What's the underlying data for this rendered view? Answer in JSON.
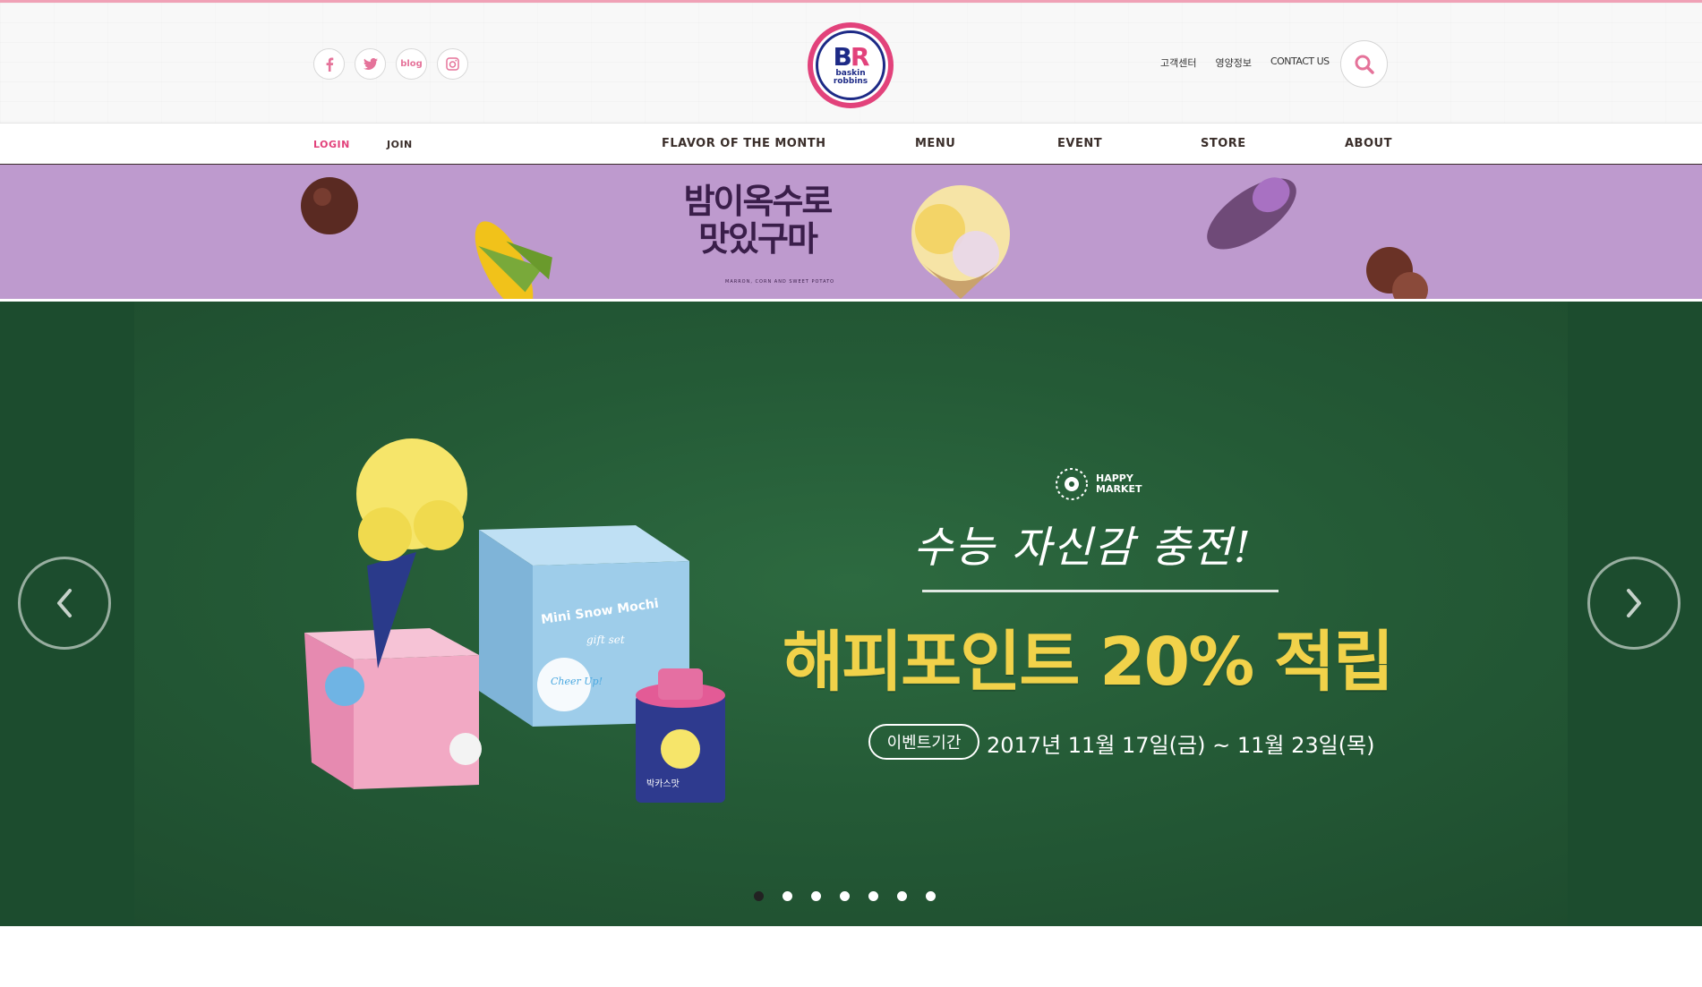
{
  "header": {
    "social": [
      {
        "name": "facebook",
        "label": "f"
      },
      {
        "name": "twitter",
        "label": ""
      },
      {
        "name": "blog",
        "label": "blog"
      },
      {
        "name": "instagram",
        "label": ""
      }
    ],
    "logo": {
      "initials_b": "B",
      "initials_r": "R",
      "line1": "baskin",
      "line2": "robbins"
    },
    "utility_links": [
      "고객센터",
      "영양정보",
      "CONTACT US"
    ]
  },
  "nav": {
    "login": "LOGIN",
    "join": "JOIN",
    "items": [
      "FLAVOR OF THE MONTH",
      "MENU",
      "EVENT",
      "STORE",
      "ABOUT"
    ]
  },
  "flavor_banner": {
    "title": "밤이옥수로 맛있구마",
    "caption": "MARRON, CORN AND SWEET POTATO"
  },
  "hero": {
    "brand": {
      "line1": "HAPPY",
      "line2": "MARKET"
    },
    "headline": "수능 자신감 충전!",
    "promo": "해피포인트 20% 적립",
    "period_label": "이벤트기간",
    "period": "2017년 11월 17일(금) ~ 11월 23일(목)",
    "products": {
      "box1": "Mini Snow Mochi",
      "box1_sub": "gift set",
      "cheer": "Cheer Up!",
      "cup": "박카스맛"
    }
  },
  "carousel": {
    "total": 7,
    "active": 1
  },
  "colors": {
    "brand_pink": "#e2427b",
    "brand_navy": "#1d2a86",
    "chalkboard": "#245a36",
    "promo_yellow": "#f1d24a",
    "banner_purple": "#be9ace"
  }
}
